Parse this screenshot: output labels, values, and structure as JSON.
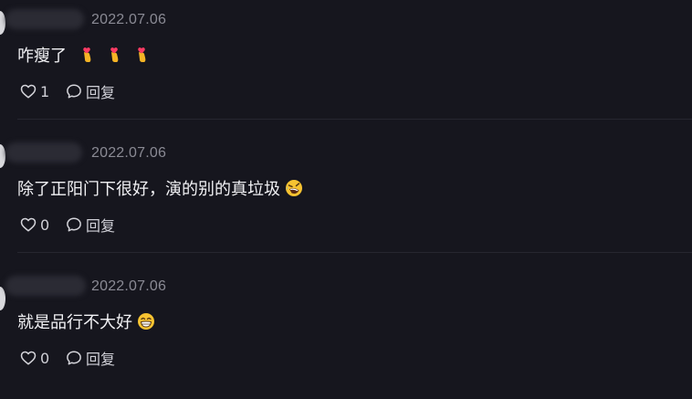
{
  "comments": [
    {
      "timestamp": "2022.07.06",
      "text": "咋瘦了",
      "emojis": [
        "finger-heart-icon",
        "finger-heart-icon",
        "finger-heart-icon"
      ],
      "like_count": "1",
      "reply_label": "回复"
    },
    {
      "timestamp": "2022.07.06",
      "text": "除了正阳门下很好，演的别的真垃圾",
      "emojis": [
        "rolling-laughing-icon"
      ],
      "like_count": "0",
      "reply_label": "回复"
    },
    {
      "timestamp": "2022.07.06",
      "text": "就是品行不大好",
      "emojis": [
        "grinning-face-icon"
      ],
      "like_count": "0",
      "reply_label": "回复"
    }
  ]
}
